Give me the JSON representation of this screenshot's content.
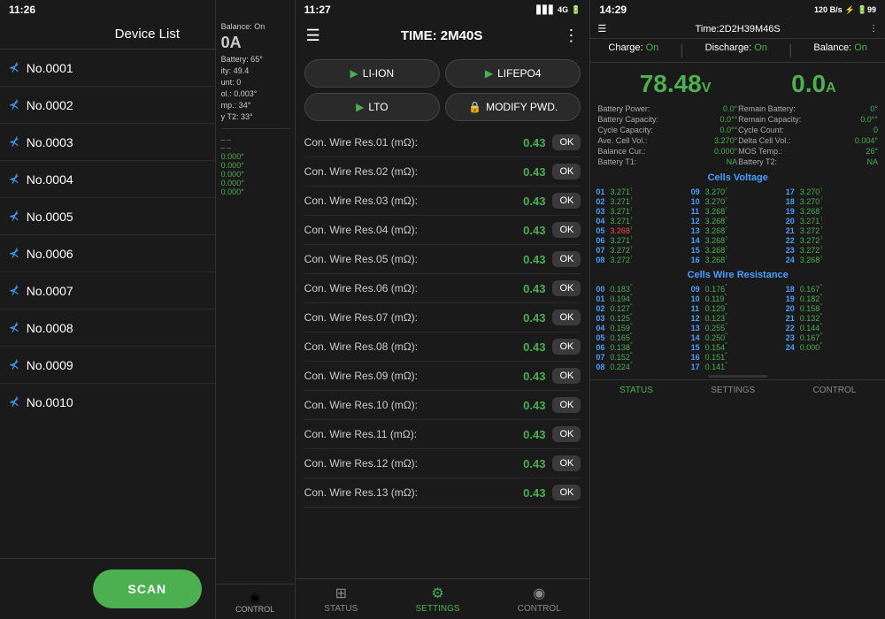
{
  "screen1": {
    "status_time": "11:26",
    "status_icons": "▋▋ ▲ 🔋",
    "title": "Device List",
    "devices": [
      {
        "name": "No.0001",
        "has_edit": false
      },
      {
        "name": "No.0002",
        "has_edit": false
      },
      {
        "name": "No.0003",
        "has_edit": false
      },
      {
        "name": "No.0004",
        "has_edit": false
      },
      {
        "name": "No.0005",
        "has_edit": false
      },
      {
        "name": "No.0006",
        "has_edit": false
      },
      {
        "name": "No.0007",
        "has_edit": false
      },
      {
        "name": "No.0008",
        "has_edit": false
      },
      {
        "name": "No.0009",
        "has_edit": false
      },
      {
        "name": "No.0010",
        "has_edit": true
      }
    ],
    "scan_label": "SCAN",
    "partial": {
      "balance_on": "Balance: On",
      "current": "0A",
      "battery_temp": "Battery: 65°",
      "capacity": "49.4",
      "cycle_count": "0",
      "vol": "0.003°",
      "temp": "34°",
      "battery_t2": "33°",
      "control_label": "CONTROL"
    }
  },
  "screen2": {
    "status_time": "11:27",
    "status_icons": "4G 🔋",
    "title": "TIME: 2M40S",
    "buttons": [
      {
        "label": "LI-ION",
        "icon": "▶",
        "type": "nav"
      },
      {
        "label": "LIFEPO4",
        "icon": "▶",
        "type": "nav"
      },
      {
        "label": "LTO",
        "icon": "▶",
        "type": "nav"
      },
      {
        "label": "MODIFY PWD.",
        "icon": "🔒",
        "type": "lock"
      }
    ],
    "resistances": [
      {
        "label": "Con. Wire Res.01 (mΩ):",
        "value": "0.43"
      },
      {
        "label": "Con. Wire Res.02 (mΩ):",
        "value": "0.43"
      },
      {
        "label": "Con. Wire Res.03 (mΩ):",
        "value": "0.43"
      },
      {
        "label": "Con. Wire Res.04 (mΩ):",
        "value": "0.43"
      },
      {
        "label": "Con. Wire Res.05 (mΩ):",
        "value": "0.43"
      },
      {
        "label": "Con. Wire Res.06 (mΩ):",
        "value": "0.43"
      },
      {
        "label": "Con. Wire Res.07 (mΩ):",
        "value": "0.43"
      },
      {
        "label": "Con. Wire Res.08 (mΩ):",
        "value": "0.43"
      },
      {
        "label": "Con. Wire Res.09 (mΩ):",
        "value": "0.43"
      },
      {
        "label": "Con. Wire Res.10 (mΩ):",
        "value": "0.43"
      },
      {
        "label": "Con. Wire Res.11 (mΩ):",
        "value": "0.43"
      },
      {
        "label": "Con. Wire Res.12 (mΩ):",
        "value": "0.43"
      },
      {
        "label": "Con. Wire Res.13 (mΩ):",
        "value": "0.43"
      }
    ],
    "ok_label": "OK",
    "nav": [
      {
        "label": "STATUS",
        "icon": "⊞",
        "active": false
      },
      {
        "label": "SETTINGS",
        "icon": "⚙",
        "active": true
      },
      {
        "label": "CONTROL",
        "icon": "◉",
        "active": false
      }
    ]
  },
  "screen3": {
    "status_time": "14:29",
    "status_icons": "120 B/S ⚡ 🔋99",
    "title": "Time:2D2H39M46S",
    "charge": "On",
    "discharge": "On",
    "balance": "On",
    "voltage": "78.48",
    "voltage_unit": "V",
    "current": "0.0",
    "current_unit": "A",
    "stats_left": [
      {
        "label": "Battery Power:",
        "val": "0.0°"
      },
      {
        "label": "Battery Capacity:",
        "val": "0.0°°"
      },
      {
        "label": "Cycle Capacity:",
        "val": "0.0°°"
      },
      {
        "label": "Ave. Cell Vol.:",
        "val": "3.270°"
      },
      {
        "label": "Balance Cur.:",
        "val": "0.000°"
      },
      {
        "label": "Battery T1:",
        "val": "NA"
      }
    ],
    "stats_right": [
      {
        "label": "Remain Battery:",
        "val": "0°"
      },
      {
        "label": "Remain Capacity:",
        "val": "0.0°°"
      },
      {
        "label": "Cycle Count:",
        "val": "0"
      },
      {
        "label": "Delta Cell Vol.:",
        "val": "0.004°"
      },
      {
        "label": "MOS Temp.:",
        "val": "26°"
      },
      {
        "label": "Battery T2:",
        "val": "NA"
      }
    ],
    "cells_voltage_title": "Cells Voltage",
    "cells_voltage": [
      {
        "num": "01",
        "val": "3.271",
        "sup": "↑"
      },
      {
        "num": "02",
        "val": "3.271",
        "sup": "↑"
      },
      {
        "num": "03",
        "val": "3.271",
        "sup": "↑"
      },
      {
        "num": "04",
        "val": "3.271",
        "sup": "↑"
      },
      {
        "num": "05",
        "val": "3.268",
        "sup": "↑",
        "red": true
      },
      {
        "num": "06",
        "val": "3.271",
        "sup": "↑"
      },
      {
        "num": "07",
        "val": "3.272",
        "sup": "↑"
      },
      {
        "num": "08",
        "val": "3.272",
        "sup": "↑"
      },
      {
        "num": "09",
        "val": "3.270",
        "sup": "↑"
      },
      {
        "num": "10",
        "val": "3.270",
        "sup": "↑"
      },
      {
        "num": "11",
        "val": "3.268",
        "sup": "↑"
      },
      {
        "num": "12",
        "val": "3.268",
        "sup": "↑"
      },
      {
        "num": "13",
        "val": "3.268",
        "sup": "↑"
      },
      {
        "num": "14",
        "val": "3.268",
        "sup": "↑"
      },
      {
        "num": "15",
        "val": "3.268",
        "sup": "↑"
      },
      {
        "num": "16",
        "val": "3.268",
        "sup": "↑"
      },
      {
        "num": "17",
        "val": "3.270",
        "sup": "↑"
      },
      {
        "num": "18",
        "val": "3.270",
        "sup": "↑"
      },
      {
        "num": "19",
        "val": "3.268",
        "sup": "↑"
      },
      {
        "num": "20",
        "val": "3.271",
        "sup": "↑"
      },
      {
        "num": "21",
        "val": "3.272",
        "sup": "↑"
      },
      {
        "num": "22",
        "val": "3.272",
        "sup": "↑"
      },
      {
        "num": "23",
        "val": "3.272",
        "sup": "↑"
      },
      {
        "num": "24",
        "val": "3.268",
        "sup": "↑"
      }
    ],
    "cells_resistance_title": "Cells Wire Resistance",
    "cells_resistance": [
      {
        "num": "00",
        "val": "0.183",
        "sup": "°"
      },
      {
        "num": "01",
        "val": "0.194",
        "sup": "°"
      },
      {
        "num": "02",
        "val": "0.127",
        "sup": "°"
      },
      {
        "num": "03",
        "val": "0.125",
        "sup": "°"
      },
      {
        "num": "04",
        "val": "0.159",
        "sup": "°"
      },
      {
        "num": "05",
        "val": "0.165",
        "sup": "°"
      },
      {
        "num": "06",
        "val": "0.138",
        "sup": "°"
      },
      {
        "num": "07",
        "val": "0.152",
        "sup": "°"
      },
      {
        "num": "08",
        "val": "0.224",
        "sup": "°"
      },
      {
        "num": "09",
        "val": "0.176",
        "sup": "°"
      },
      {
        "num": "10",
        "val": "0.119",
        "sup": "°"
      },
      {
        "num": "11",
        "val": "0.129",
        "sup": "°"
      },
      {
        "num": "12",
        "val": "0.123",
        "sup": "°"
      },
      {
        "num": "13",
        "val": "0.255",
        "sup": "°"
      },
      {
        "num": "14",
        "val": "0.250",
        "sup": "°"
      },
      {
        "num": "15",
        "val": "0.154",
        "sup": "°"
      },
      {
        "num": "16",
        "val": "0.151",
        "sup": "°"
      },
      {
        "num": "17",
        "val": "0.141",
        "sup": "°"
      },
      {
        "num": "18",
        "val": "0.167",
        "sup": "°"
      },
      {
        "num": "19",
        "val": "0.182",
        "sup": "°"
      },
      {
        "num": "20",
        "val": "0.158",
        "sup": "°"
      },
      {
        "num": "21",
        "val": "0.132",
        "sup": "°"
      },
      {
        "num": "22",
        "val": "0.144",
        "sup": "°"
      },
      {
        "num": "23",
        "val": "0.167",
        "sup": "°"
      },
      {
        "num": "24",
        "val": "0.000",
        "sup": "°"
      }
    ],
    "nav": [
      {
        "label": "STATUS",
        "active": true
      },
      {
        "label": "SETTINGS",
        "active": false
      },
      {
        "label": "CONTROL",
        "active": false
      }
    ]
  }
}
